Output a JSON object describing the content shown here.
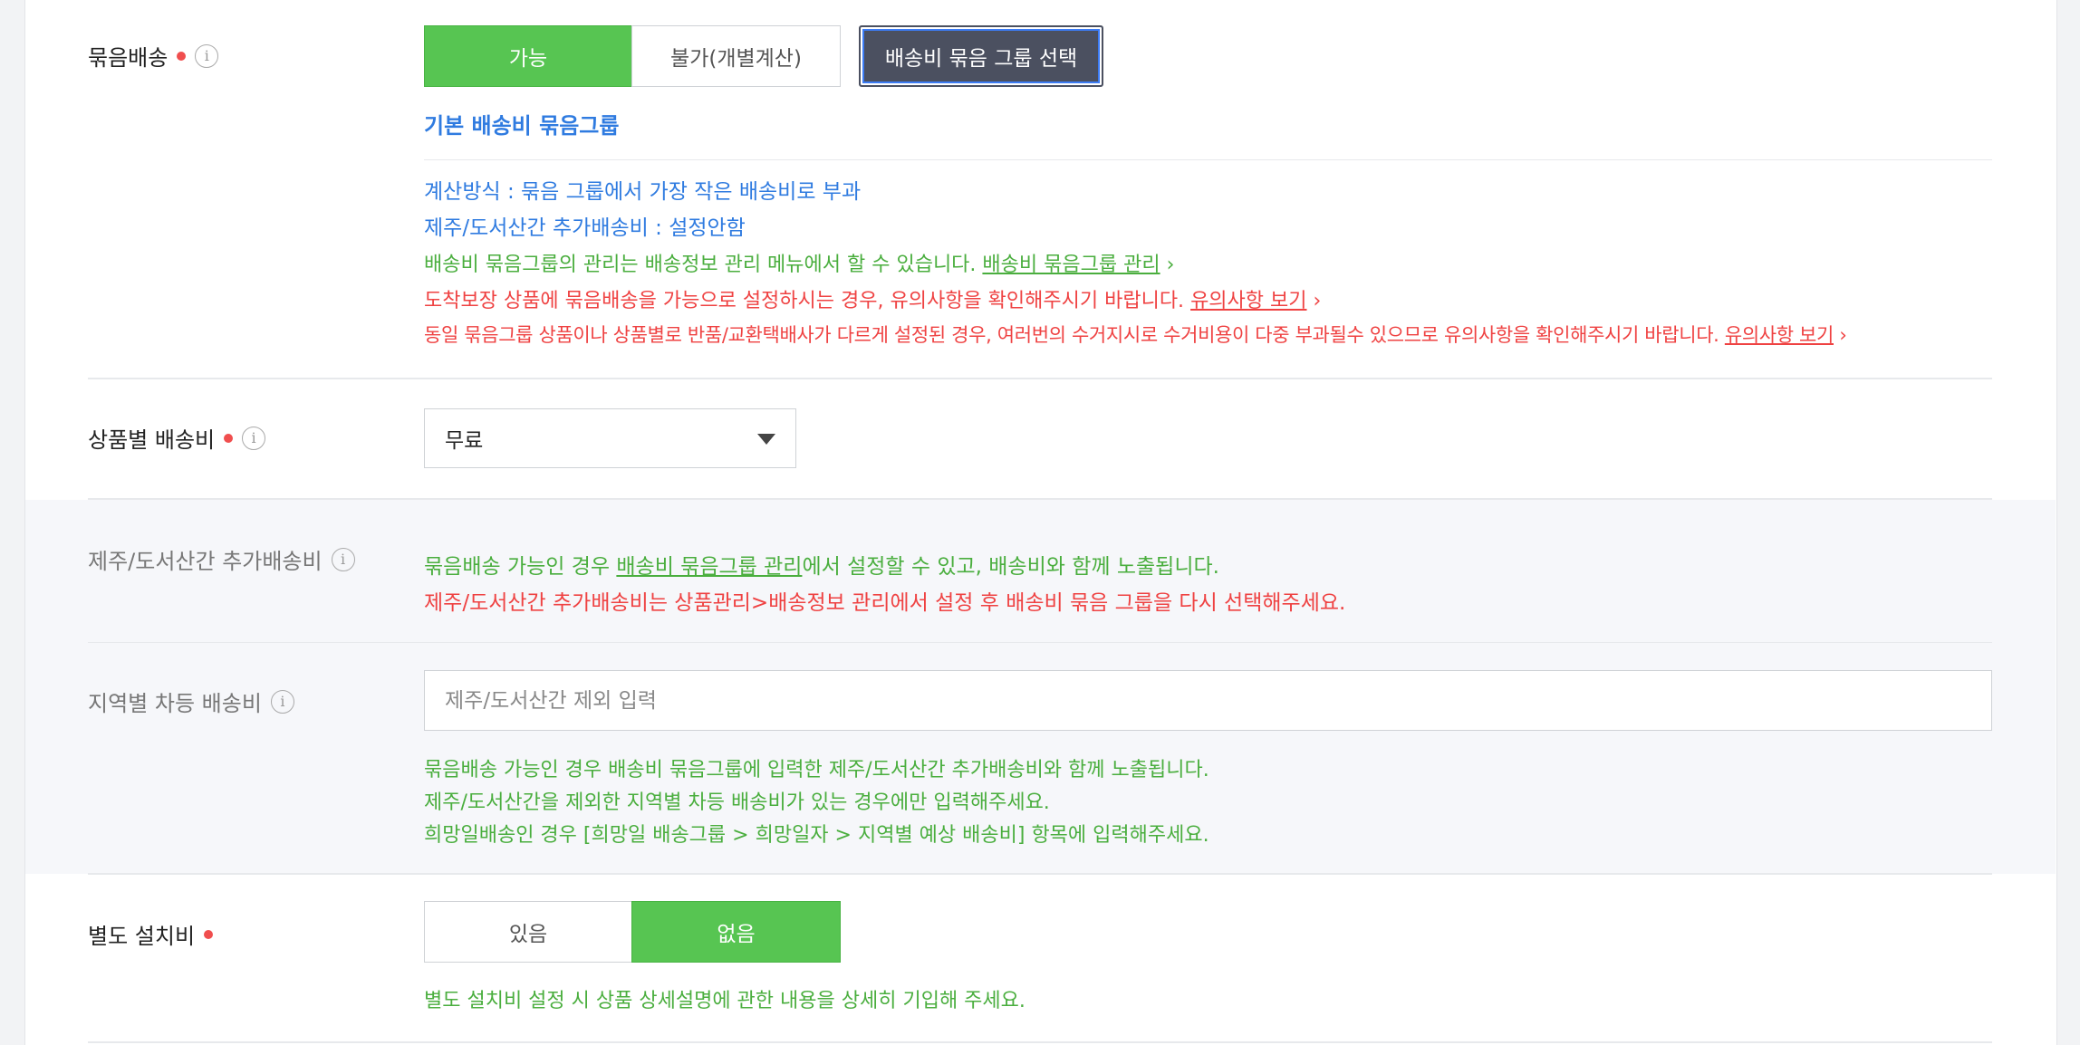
{
  "bundle": {
    "label": "묶음배송",
    "options": [
      "가능",
      "불가(개별계산)"
    ],
    "selected": "가능",
    "group_select_label": "배송비 묶음 그룹 선택",
    "group_name": "기본 배송비 묶음그룹",
    "calc_method": "계산방식 : 묶음 그룹에서 가장 작은 배송비로 부과",
    "island_fee": "제주/도서산간 추가배송비 : 설정안함",
    "manage_text": "배송비 묶음그룹의 관리는 배송정보 관리 메뉴에서 할 수 있습니다.",
    "manage_link": "배송비 묶음그룹 관리",
    "warn1_text": "도착보장 상품에 묶음배송을 가능으로 설정하시는 경우, 유의사항을 확인해주시기 바랍니다.",
    "warn2_text": "동일 묶음그룹 상품이나 상품별로 반품/교환택배사가 다르게 설정된 경우, 여러번의 수거지시로 수거비용이 다중 부과될수 있으므로 유의사항을 확인해주시기 바랍니다.",
    "notice_link": "유의사항 보기",
    "chevron": "›"
  },
  "product_fee": {
    "label": "상품별 배송비",
    "selected": "무료"
  },
  "island": {
    "label": "제주/도서산간 추가배송비",
    "line1_pre": "묶음배송 가능인 경우 ",
    "line1_link": "배송비 묶음그룹 관리",
    "line1_post": "에서 설정할 수 있고, 배송비와 함께 노출됩니다.",
    "line2": "제주/도서산간 추가배송비는 상품관리>배송정보 관리에서 설정 후 배송비 묶음 그룹을 다시 선택해주세요."
  },
  "regional": {
    "label": "지역별 차등 배송비",
    "placeholder": "제주/도서산간 제외 입력",
    "hint1": "묶음배송 가능인 경우 배송비 묶음그룹에 입력한 제주/도서산간 추가배송비와 함께 노출됩니다.",
    "hint2": "제주/도서산간을 제외한 지역별 차등 배송비가 있는 경우에만 입력해주세요.",
    "hint3": "희망일배송인 경우 [희망일 배송그룹 > 희망일자 > 지역별 예상 배송비] 항목에 입력해주세요."
  },
  "install": {
    "label": "별도 설치비",
    "options": [
      "있음",
      "없음"
    ],
    "selected": "없음",
    "hint": "별도 설치비 설정 시 상품 상세설명에 관한 내용을 상세히 기입해 주세요."
  },
  "colors": {
    "green": "#57c552",
    "blue": "#2f7be0",
    "red": "#ef4242",
    "dark_button": "#4b5060"
  },
  "icons": {
    "info": "i",
    "required": "red-dot"
  }
}
